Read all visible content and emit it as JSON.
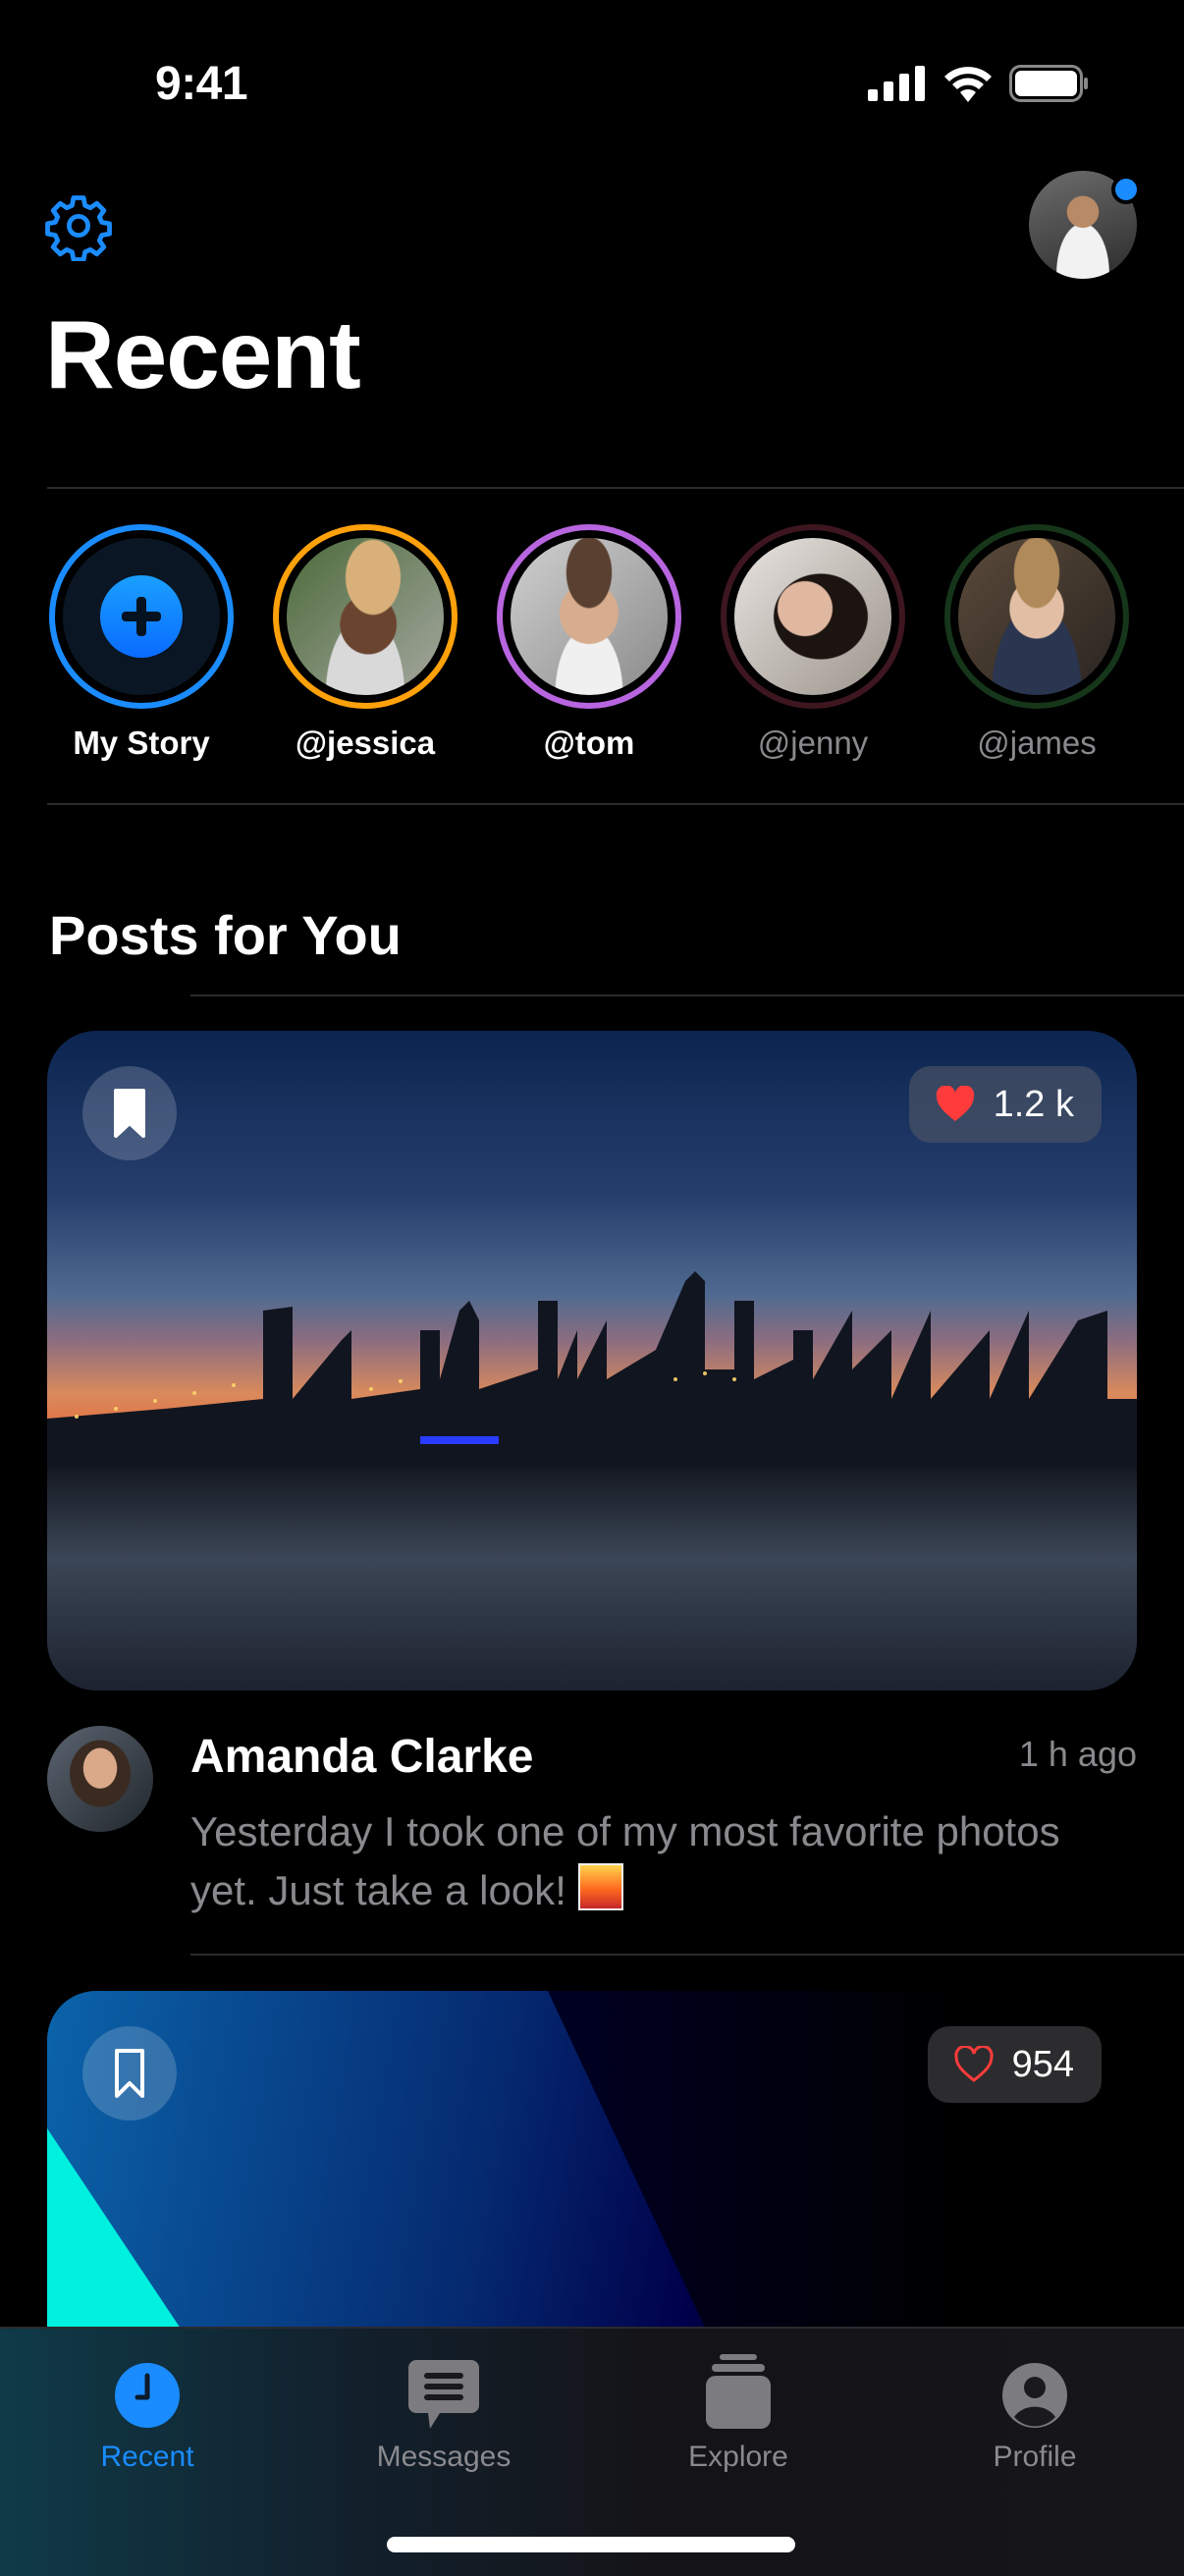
{
  "status_bar": {
    "time": "9:41"
  },
  "header": {
    "title": "Recent",
    "has_notification": true
  },
  "stories": [
    {
      "label": "My Story",
      "ring_color": "#1a8cff",
      "seen": false,
      "is_add": true
    },
    {
      "label": "@jessica",
      "ring_color": "#ffa10a",
      "seen": false
    },
    {
      "label": "@tom",
      "ring_color": "#b865e0",
      "seen": false
    },
    {
      "label": "@jenny",
      "ring_color": "#3d1620",
      "seen": true
    },
    {
      "label": "@james",
      "ring_color": "#16361a",
      "seen": true
    }
  ],
  "posts_section": {
    "title": "Posts for You"
  },
  "posts": [
    {
      "author": "Amanda Clarke",
      "time": "1 h ago",
      "text": "Yesterday I took one of my most favorite photos yet. Just take a look!",
      "emoji": "sunset-cityscape-emoji",
      "likes": "1.2 k",
      "liked": true,
      "bookmarked": true,
      "image": "city-skyline-bridge-sunset"
    },
    {
      "likes": "954",
      "liked": false,
      "bookmarked": false,
      "image": "abstract-blue-gradient"
    }
  ],
  "tabbar": {
    "tabs": [
      {
        "label": "Recent",
        "icon": "clock-icon",
        "active": true
      },
      {
        "label": "Messages",
        "icon": "message-bubble-icon",
        "active": false
      },
      {
        "label": "Explore",
        "icon": "stack-icon",
        "active": false
      },
      {
        "label": "Profile",
        "icon": "person-circle-icon",
        "active": false
      }
    ]
  },
  "colors": {
    "accent": "#1a8cff",
    "like_red": "#ff3b3b",
    "secondary_text": "#8a8a8e"
  }
}
